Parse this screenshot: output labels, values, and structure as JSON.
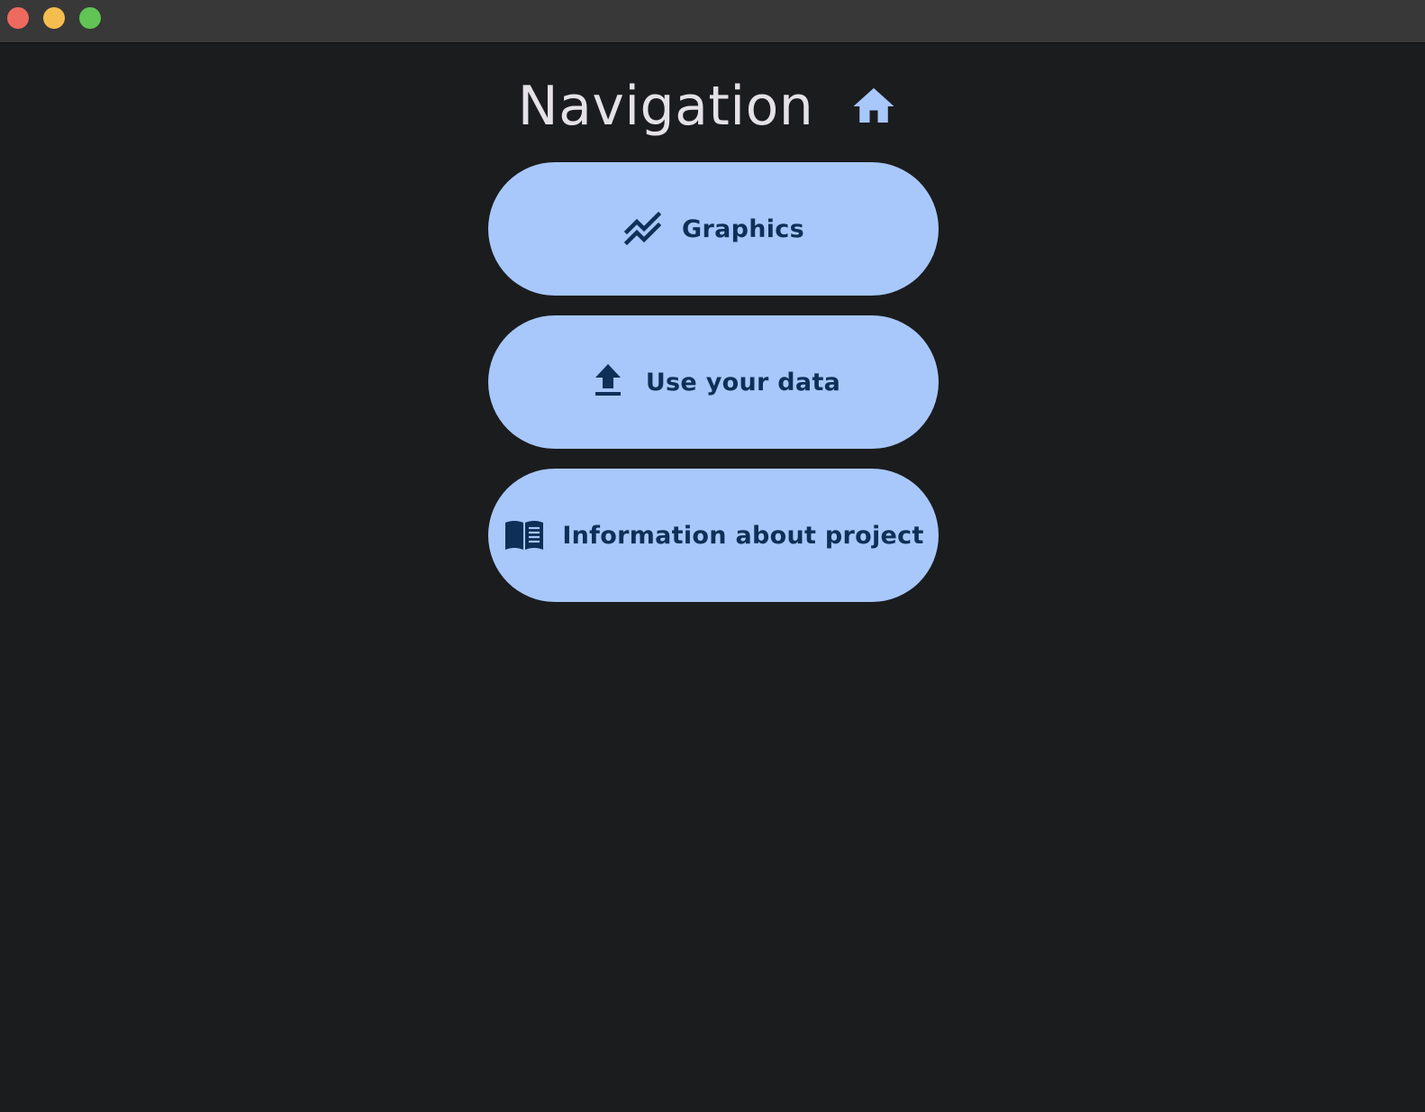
{
  "window": {
    "controls": {
      "close_color": "#ee6a5f",
      "minimize_color": "#f5bd4f",
      "maximize_color": "#61c454"
    }
  },
  "header": {
    "title": "Navigation",
    "icon": "home-icon"
  },
  "nav": {
    "items": [
      {
        "label": "Graphics",
        "icon": "trending-chart-icon"
      },
      {
        "label": "Use your data",
        "icon": "upload-icon"
      },
      {
        "label": "Information about project",
        "icon": "book-icon"
      }
    ]
  },
  "colors": {
    "background": "#1b1c1e",
    "titlebar": "#383838",
    "button_bg": "#a8c8fb",
    "button_text": "#0e2f57",
    "title_text": "#e4e2e6",
    "home_icon": "#a8c8fb"
  }
}
